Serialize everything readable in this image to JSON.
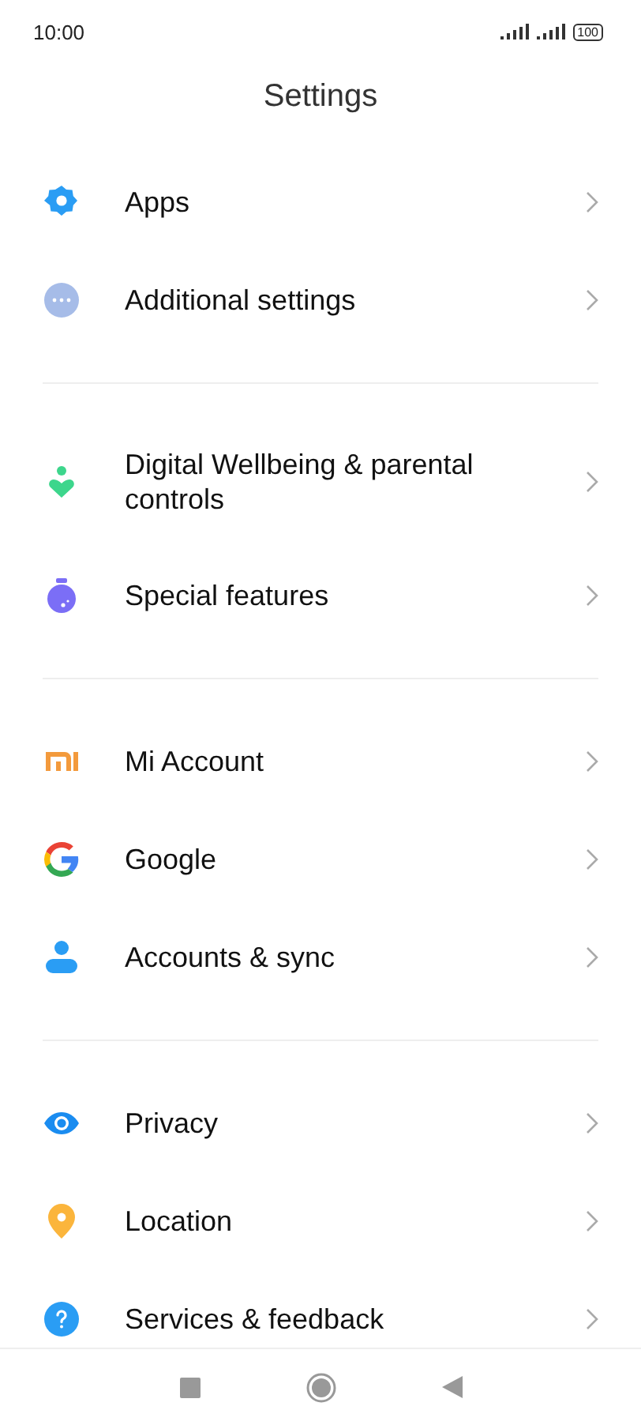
{
  "status_bar": {
    "time": "10:00",
    "battery": "100"
  },
  "title": "Settings",
  "sections": [
    {
      "items": [
        {
          "kind": "gear",
          "label": "Apps"
        },
        {
          "kind": "dots",
          "label": "Additional settings"
        }
      ]
    },
    {
      "items": [
        {
          "kind": "wellbeing",
          "label": "Digital Wellbeing & parental controls"
        },
        {
          "kind": "flask",
          "label": "Special features"
        }
      ]
    },
    {
      "items": [
        {
          "kind": "mi",
          "label": "Mi Account"
        },
        {
          "kind": "google",
          "label": "Google"
        },
        {
          "kind": "person",
          "label": "Accounts & sync"
        }
      ]
    },
    {
      "items": [
        {
          "kind": "eye",
          "label": "Privacy"
        },
        {
          "kind": "pin",
          "label": "Location"
        },
        {
          "kind": "help",
          "label": "Services & feedback"
        }
      ]
    }
  ]
}
